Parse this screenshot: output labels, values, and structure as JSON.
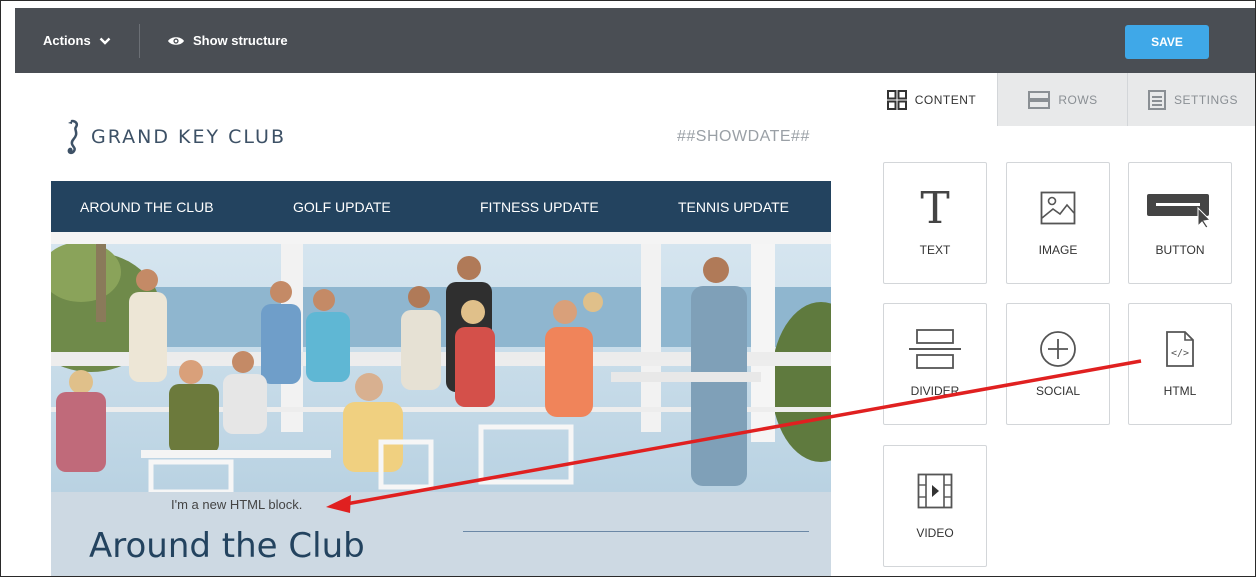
{
  "toolbar": {
    "actions_label": "Actions",
    "show_structure_label": "Show structure",
    "save_label": "SAVE"
  },
  "email": {
    "logo_text": "GRAND KEY CLUB",
    "showdate": "##SHOWDATE##",
    "nav": [
      "AROUND THE CLUB",
      "GOLF UPDATE",
      "FITNESS UPDATE",
      "TENNIS UPDATE"
    ],
    "html_block_text": "I'm a new HTML block.",
    "section_heading": "Around the Club"
  },
  "panel": {
    "tabs": [
      "CONTENT",
      "ROWS",
      "SETTINGS"
    ],
    "tiles": [
      "TEXT",
      "IMAGE",
      "BUTTON",
      "DIVIDER",
      "SOCIAL",
      "HTML",
      "VIDEO"
    ]
  },
  "colors": {
    "toolbar_bg": "#4a4e54",
    "save_button": "#3fa8e8",
    "nav_bg": "#23435f",
    "block_bg": "#cdd9e3",
    "arrow": "#e02020"
  }
}
